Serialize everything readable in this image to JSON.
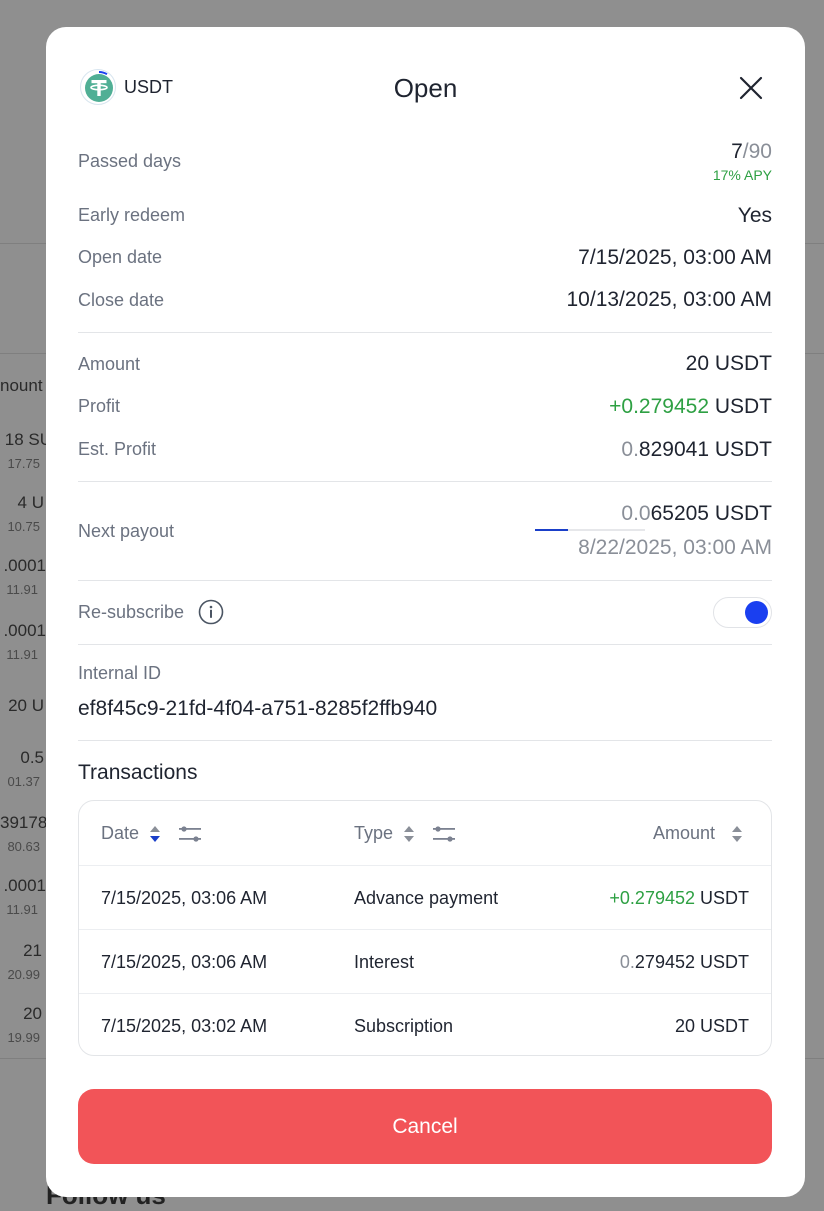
{
  "background": {
    "left_column": [
      {
        "main": "nount",
        "sub": ""
      },
      {
        "main": "18 SU",
        "sub": "17.75"
      },
      {
        "main": "4 U",
        "sub": "10.75"
      },
      {
        "main": ".0001",
        "sub": "11.91"
      },
      {
        "main": ".0001",
        "sub": "11.91"
      },
      {
        "main": "20 U",
        "sub": ""
      },
      {
        "main": "0.5",
        "sub": "01.37"
      },
      {
        "main": "39178",
        "sub": "80.63"
      },
      {
        "main": ".0001",
        "sub": "11.91"
      },
      {
        "main": "21",
        "sub": "20.99"
      },
      {
        "main": "20",
        "sub": "19.99"
      }
    ],
    "footer_heading": "Follow us"
  },
  "modal": {
    "coin": "USDT",
    "title": "Open",
    "details": {
      "passed_days": {
        "label": "Passed days",
        "current": "7",
        "total": "/90",
        "apy": "17% APY"
      },
      "early_redeem": {
        "label": "Early redeem",
        "value": "Yes"
      },
      "open_date": {
        "label": "Open date",
        "value": "7/15/2025, 03:00 AM"
      },
      "close_date": {
        "label": "Close date",
        "value": "10/13/2025, 03:00 AM"
      },
      "amount": {
        "label": "Amount",
        "value": "20 USDT"
      },
      "profit": {
        "label": "Profit",
        "value_colored": "+0.279452",
        "unit": " USDT"
      },
      "est_profit": {
        "label": "Est. Profit",
        "value_dim": "0.",
        "value_main": "829041 USDT"
      },
      "next_payout": {
        "label": "Next payout",
        "value_dim": "0.0",
        "value_main": "65205 USDT",
        "date": "8/22/2025, 03:00 AM",
        "progress_percent": 30
      },
      "resubscribe": {
        "label": "Re-subscribe",
        "enabled": true
      },
      "internal_id": {
        "label": "Internal ID",
        "value": "ef8f45c9-21fd-4f04-a751-8285f2ffb940"
      }
    },
    "transactions": {
      "title": "Transactions",
      "headers": {
        "date": "Date",
        "type": "Type",
        "amount": "Amount"
      },
      "rows": [
        {
          "date": "7/15/2025, 03:06 AM",
          "type": "Advance payment",
          "amount_colored": "+0.279452",
          "amount_dim": "",
          "amount_rest": " USDT"
        },
        {
          "date": "7/15/2025, 03:06 AM",
          "type": "Interest",
          "amount_colored": "",
          "amount_dim": "0.",
          "amount_rest": "279452 USDT"
        },
        {
          "date": "7/15/2025, 03:02 AM",
          "type": "Subscription",
          "amount_colored": "",
          "amount_dim": "",
          "amount_rest": "20 USDT"
        }
      ]
    },
    "cancel_label": "Cancel"
  },
  "colors": {
    "accent_blue": "#1a3ff0",
    "profit_green": "#2ea043",
    "cancel_red": "#f25458",
    "tether_green": "#50af95"
  }
}
